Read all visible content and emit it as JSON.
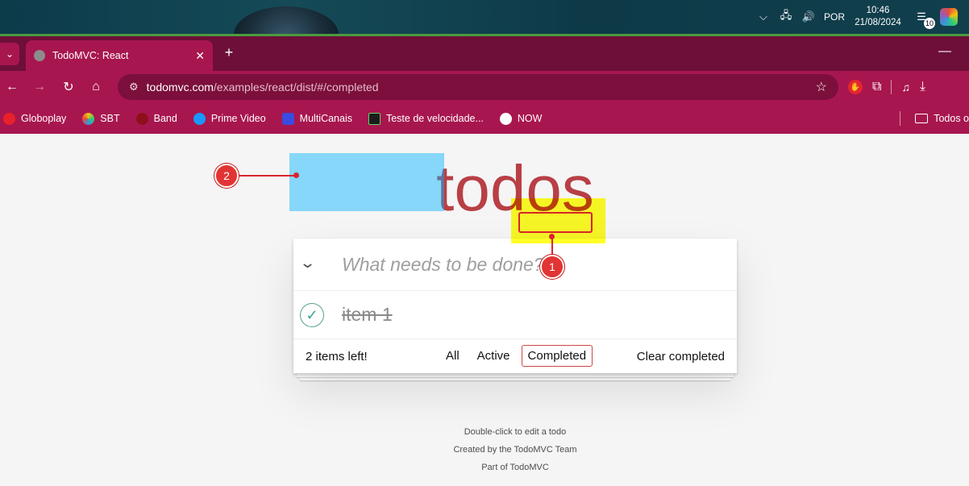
{
  "taskbar": {
    "language": "POR",
    "time": "10:46",
    "date": "21/08/2024",
    "notification_count": "10"
  },
  "browser": {
    "tab_title": "TodoMVC: React",
    "url_host": "todomvc.com",
    "url_path": "/examples/react/dist/#/completed",
    "bookmarks": [
      "Globoplay",
      "SBT",
      "Band",
      "Prime Video",
      "MultiCanais",
      "Teste de velocidade...",
      "NOW"
    ],
    "bookmarks_folder": "Todos o"
  },
  "app": {
    "title": "todos",
    "new_todo_placeholder": "What needs to be done?",
    "items": [
      {
        "label": "item 1",
        "completed": true
      }
    ],
    "count_text": "2 items left!",
    "filters": [
      "All",
      "Active",
      "Completed"
    ],
    "selected_filter": "Completed",
    "clear_completed": "Clear completed"
  },
  "info": {
    "line1": "Double-click to edit a todo",
    "line2": "Created by the TodoMVC Team",
    "line3": "Part of TodoMVC"
  },
  "annotations": {
    "marker1": "1",
    "marker2": "2"
  },
  "colors": {
    "title": "#b83f45",
    "browser_accent": "#a8164f",
    "highlight_yellow": "#ffff00",
    "highlight_blue": "#00b4ff",
    "marker_red": "#e23434"
  }
}
